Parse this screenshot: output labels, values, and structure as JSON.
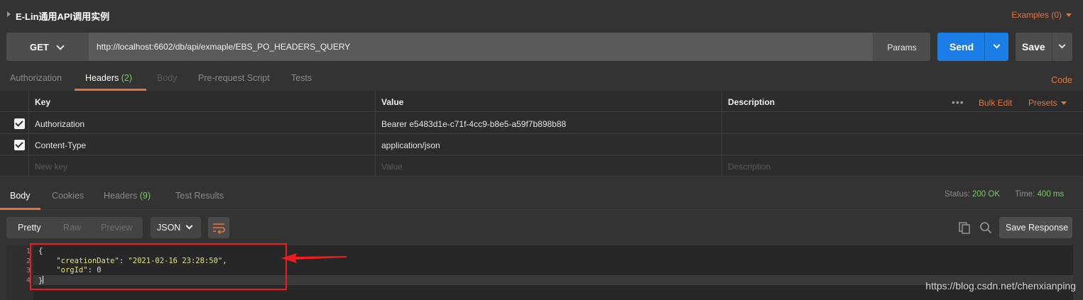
{
  "title": "E-Lin通用API调用实例",
  "examples_label": "Examples (0)",
  "request": {
    "method": "GET",
    "url": "http://localhost:6602/db/api/exmaple/EBS_PO_HEADERS_QUERY",
    "params_label": "Params",
    "send_label": "Send",
    "save_label": "Save"
  },
  "request_tabs": {
    "authorization": "Authorization",
    "headers": "Headers",
    "headers_count": "(2)",
    "body": "Body",
    "prerequest": "Pre-request Script",
    "tests": "Tests",
    "code": "Code"
  },
  "headers_table": {
    "columns": [
      "Key",
      "Value",
      "Description"
    ],
    "bulk_edit": "Bulk Edit",
    "presets": "Presets",
    "rows": [
      {
        "key": "Authorization",
        "value": "Bearer e5483d1e-c71f-4cc9-b8e5-a59f7b898b88",
        "checked": true
      },
      {
        "key": "Content-Type",
        "value": "application/json",
        "checked": true
      }
    ],
    "placeholders": {
      "key": "New key",
      "value": "Value",
      "description": "Description"
    }
  },
  "response_tabs": {
    "body": "Body",
    "cookies": "Cookies",
    "headers": "Headers",
    "headers_count": "(9)",
    "test_results": "Test Results",
    "status_label": "Status:",
    "status_value": "200 OK",
    "time_label": "Time:",
    "time_value": "400 ms"
  },
  "response_toolbar": {
    "pretty": "Pretty",
    "raw": "Raw",
    "preview": "Preview",
    "format": "JSON",
    "save_response": "Save Response"
  },
  "response_body": {
    "line_numbers": [
      "1",
      "2",
      "3",
      "4"
    ],
    "open_brace": "{",
    "close_brace": "}",
    "key1": "\"creationDate\"",
    "val1": "\"2021-02-16 23:28:50\"",
    "key2": "\"orgId\"",
    "val2": "0"
  },
  "watermark": "https://blog.csdn.net/chenxianping",
  "colors": {
    "accent": "#e4753a",
    "send": "#1a7ee6",
    "ok": "#7ec86b",
    "annotation": "#ee1c1c"
  }
}
